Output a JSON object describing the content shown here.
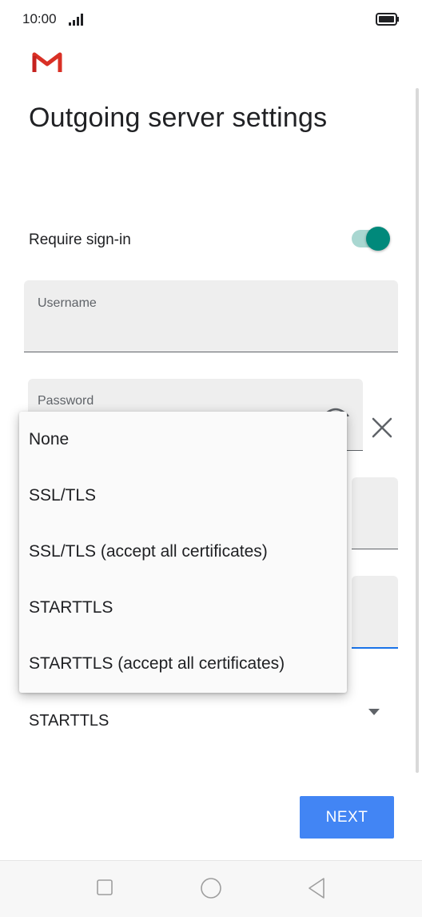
{
  "status_bar": {
    "time": "10:00"
  },
  "header": {
    "title": "Outgoing server settings"
  },
  "require_signin": {
    "label": "Require sign-in",
    "enabled": true
  },
  "fields": {
    "username_label": "Username",
    "password_label": "Password"
  },
  "security": {
    "selected": "STARTTLS"
  },
  "menu": {
    "items": [
      "None",
      "SSL/TLS",
      "SSL/TLS (accept all certificates)",
      "STARTTLS",
      "STARTTLS (accept all certificates)"
    ]
  },
  "actions": {
    "next_label": "NEXT"
  },
  "colors": {
    "accent": "#4285f4",
    "toggle": "#00897b",
    "gmail_red": "#d93025"
  }
}
